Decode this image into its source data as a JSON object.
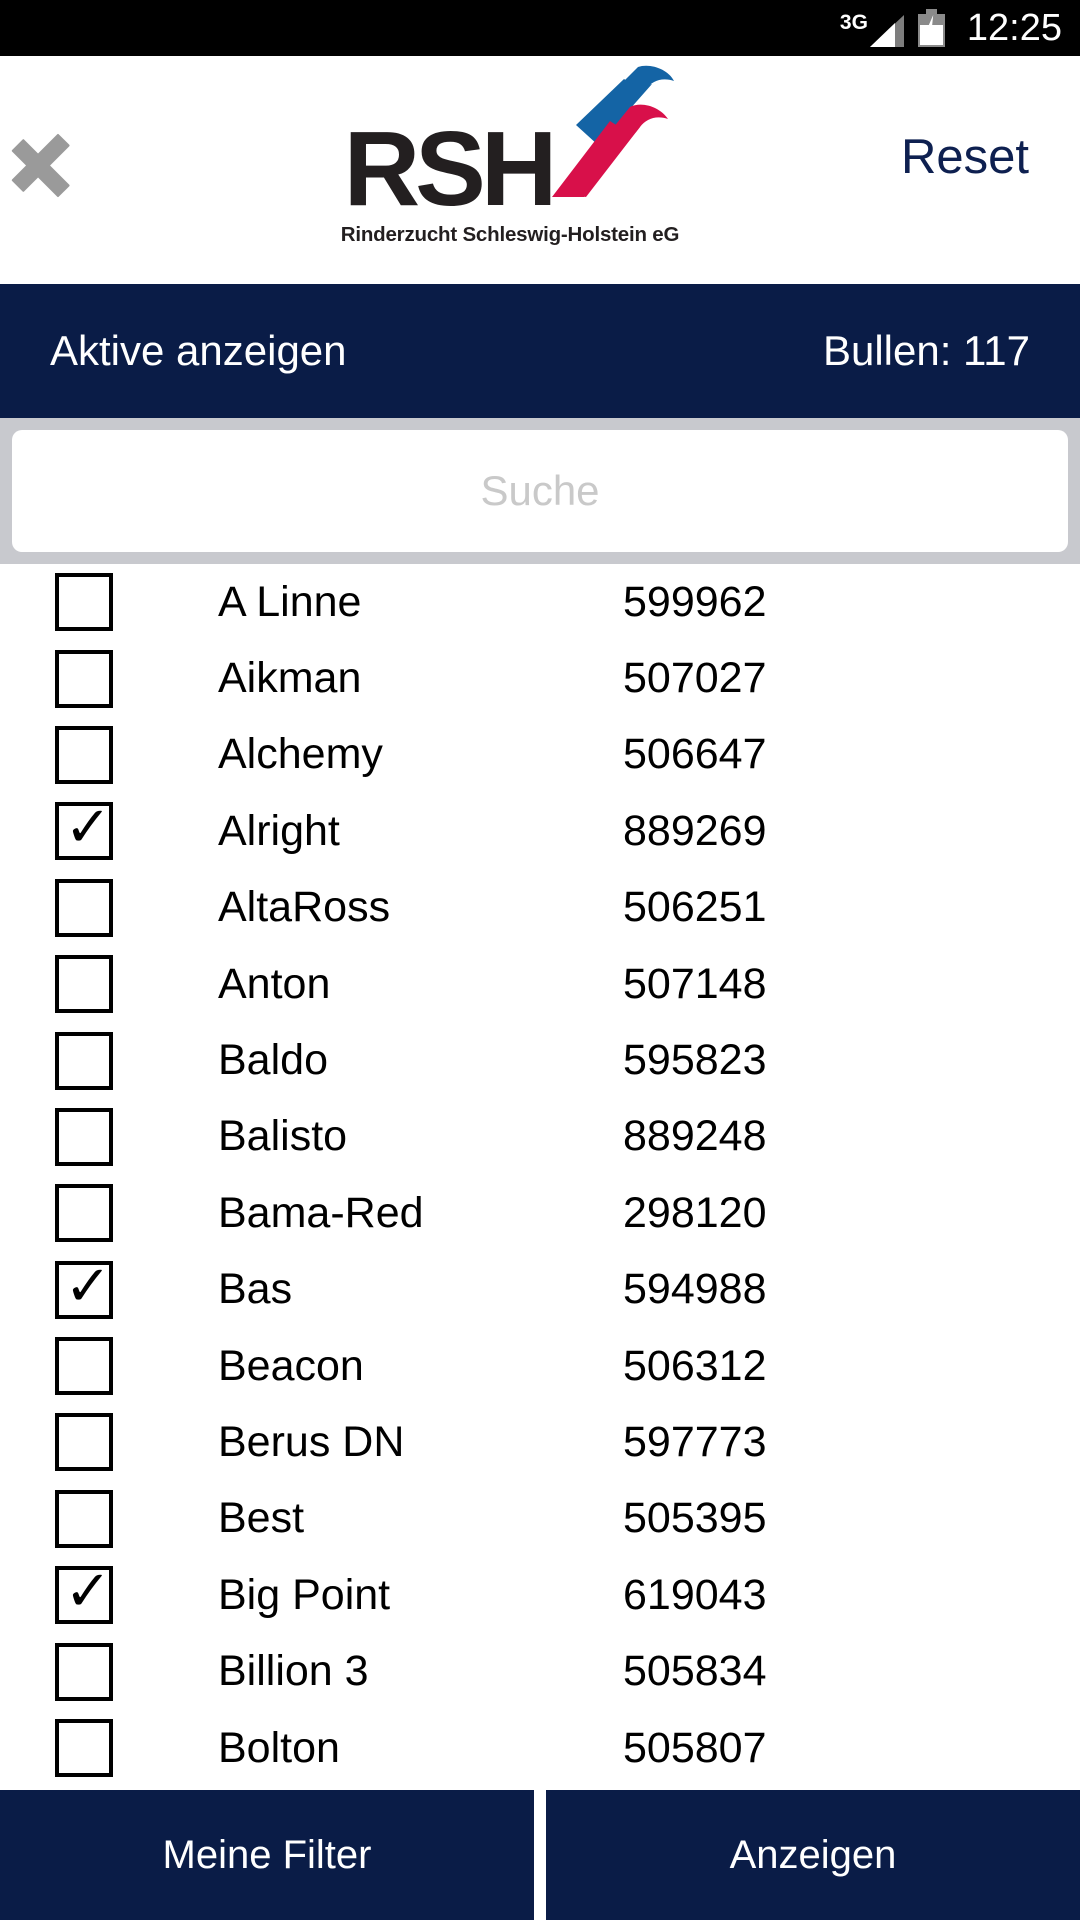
{
  "status_bar": {
    "network_label": "3G",
    "signal_icon": "signal-bars-icon",
    "battery_icon": "battery-charging-icon",
    "time": "12:25"
  },
  "header": {
    "back_icon": "chevron-left-icon",
    "logo_text": "RSH",
    "logo_icon": "rsh-swoosh-icon",
    "logo_subtitle": "Rinderzucht Schleswig-Holstein eG",
    "reset_label": "Reset"
  },
  "subbar": {
    "active_label": "Aktive anzeigen",
    "count_label": "Bullen: 117"
  },
  "search": {
    "placeholder": "Suche",
    "value": ""
  },
  "list": {
    "rows": [
      {
        "checked": false,
        "name": "A Linne",
        "number": "599962"
      },
      {
        "checked": false,
        "name": "Aikman",
        "number": "507027"
      },
      {
        "checked": false,
        "name": "Alchemy",
        "number": "506647"
      },
      {
        "checked": true,
        "name": "Alright",
        "number": "889269"
      },
      {
        "checked": false,
        "name": "AltaRoss",
        "number": "506251"
      },
      {
        "checked": false,
        "name": "Anton",
        "number": "507148"
      },
      {
        "checked": false,
        "name": "Baldo",
        "number": "595823"
      },
      {
        "checked": false,
        "name": "Balisto",
        "number": "889248"
      },
      {
        "checked": false,
        "name": "Bama-Red",
        "number": "298120"
      },
      {
        "checked": true,
        "name": "Bas",
        "number": "594988"
      },
      {
        "checked": false,
        "name": "Beacon",
        "number": "506312"
      },
      {
        "checked": false,
        "name": "Berus DN",
        "number": "597773"
      },
      {
        "checked": false,
        "name": "Best",
        "number": "505395"
      },
      {
        "checked": true,
        "name": "Big Point",
        "number": "619043"
      },
      {
        "checked": false,
        "name": "Billion 3",
        "number": "505834"
      },
      {
        "checked": false,
        "name": "Bolton",
        "number": "505807"
      }
    ],
    "checkmark_glyph": "✓"
  },
  "bottom_bar": {
    "my_filters_label": "Meine Filter",
    "show_label": "Anzeigen"
  },
  "colors": {
    "navy": "#0a1c47",
    "reset_navy": "#0e2050",
    "logo_blue": "#1464a5",
    "logo_red": "#d8104a",
    "gray_band": "#c8c9ce",
    "chevron_gray": "#9a9a9a",
    "placeholder_gray": "#c9c9c9"
  }
}
